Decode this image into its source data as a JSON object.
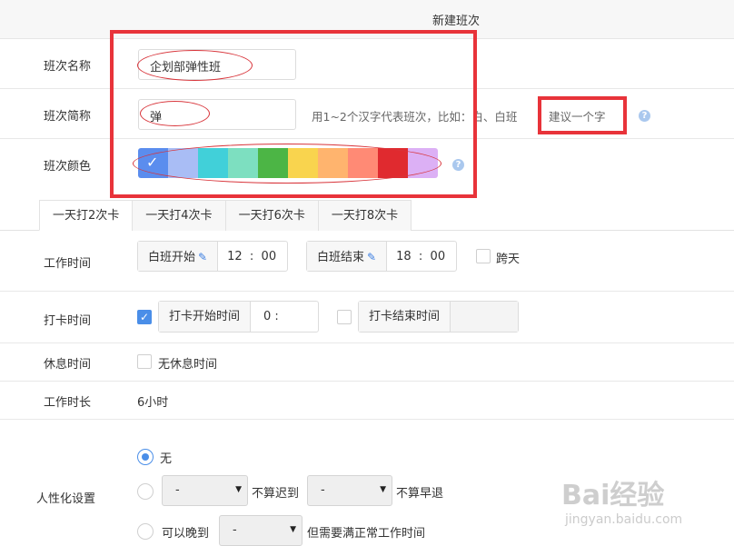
{
  "window": {
    "title": "新建班次"
  },
  "form": {
    "name": {
      "label": "班次名称",
      "value": "企划部弹性班"
    },
    "short": {
      "label": "班次简称",
      "value": "弹",
      "hint": "用1~2个汉字代表班次，比如：白、白班",
      "hint_boxed": "建议一个字"
    },
    "color": {
      "label": "班次颜色",
      "swatches": [
        "#5b8dee",
        "#a9bdf5",
        "#41d0d9",
        "#7ddfc0",
        "#4cb545",
        "#f9d44e",
        "#ffb46e",
        "#ff8a75",
        "#e02a2f",
        "#dcb0f5"
      ],
      "selected_index": 0
    }
  },
  "help_icon": "?",
  "tabs": [
    {
      "label": "一天打2次卡",
      "active": true
    },
    {
      "label": "一天打4次卡",
      "active": false
    },
    {
      "label": "一天打6次卡",
      "active": false
    },
    {
      "label": "一天打8次卡",
      "active": false
    }
  ],
  "work_time": {
    "label": "工作时间",
    "start": {
      "label": "白班开始",
      "hour": "12",
      "sep": ":",
      "minute": "00"
    },
    "end": {
      "label": "白班结束",
      "hour": "18",
      "sep": ":",
      "minute": "00"
    },
    "cross_day": {
      "label": "跨天",
      "checked": false
    }
  },
  "punch_time": {
    "label": "打卡时间",
    "start": {
      "label": "打卡开始时间",
      "checked": true,
      "value": "0 :"
    },
    "end": {
      "label": "打卡结束时间",
      "checked": false,
      "value": ""
    }
  },
  "rest_time": {
    "label": "休息时间",
    "option": "无休息时间",
    "checked": false
  },
  "work_duration": {
    "label": "工作时长",
    "value": "6小时"
  },
  "humanize": {
    "label": "人性化设置",
    "opt_none": "无",
    "opt_late_a": "-",
    "opt_late_a_text": "不算迟到",
    "opt_late_b": "-",
    "opt_late_b_text": "不算早退",
    "opt_late2_pre": "可以晚到",
    "opt_late2_val": "-",
    "opt_late2_post": "但需要满正常工作时间",
    "selected": 0
  },
  "watermark": {
    "line1": "Bai经验",
    "line2": "jingyan.baidu.com"
  },
  "colors": {
    "accent": "#4a8ee8",
    "annotation": "#e8333a"
  }
}
